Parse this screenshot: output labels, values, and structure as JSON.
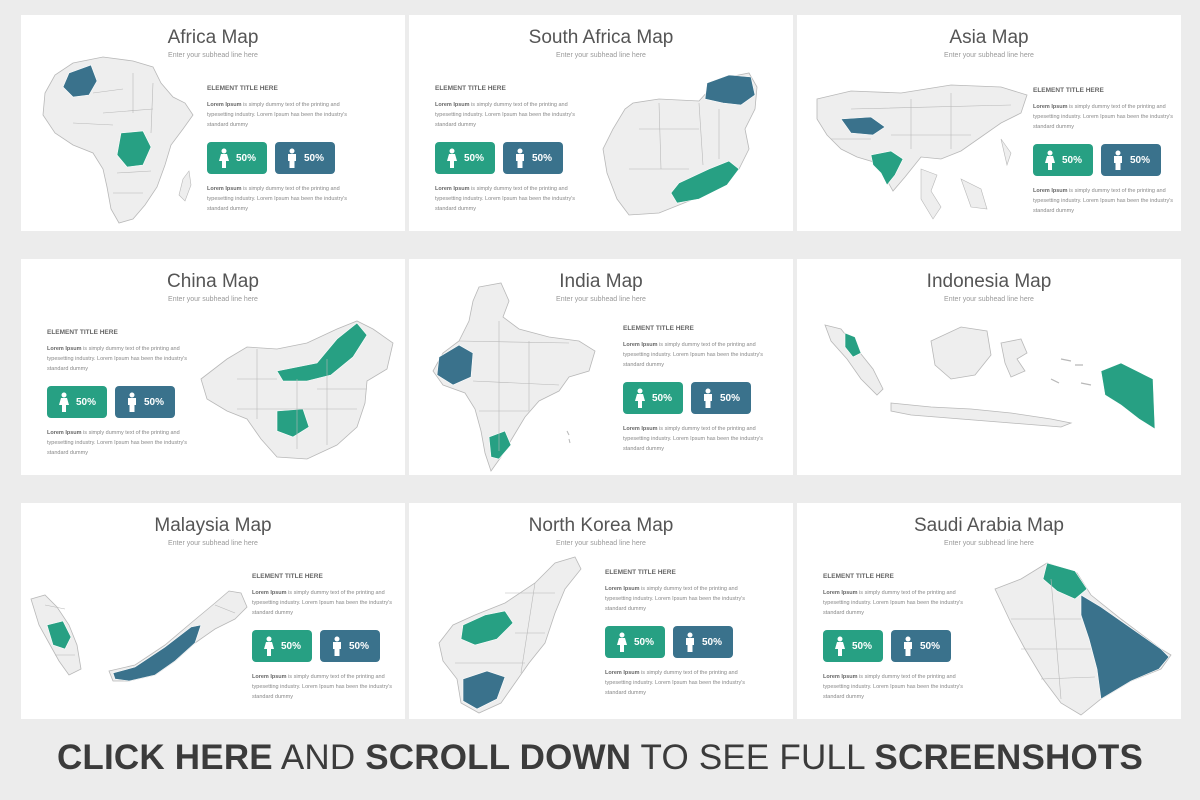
{
  "colors": {
    "teal": "#27a083",
    "blue": "#3a728c",
    "land": "#eeeeee",
    "border": "#b8b8b8"
  },
  "common": {
    "subhead": "Enter your subhead line here",
    "element_title": "ELEMENT TITLE HERE",
    "lorem_bold": "Lorem Ipsum",
    "lorem_rest": " is simply dummy text of the printing and typesetting industry. Lorem Ipsum has been the industry's standard dummy",
    "female_pct": "50%",
    "male_pct": "50%",
    "female_icon": "female-person-icon",
    "male_icon": "male-person-icon"
  },
  "slides": [
    {
      "title": "Africa Map"
    },
    {
      "title": "South Africa Map"
    },
    {
      "title": "Asia Map"
    },
    {
      "title": "China Map"
    },
    {
      "title": "India Map"
    },
    {
      "title": "Indonesia Map"
    },
    {
      "title": "Malaysia Map"
    },
    {
      "title": "North Korea Map"
    },
    {
      "title": "Saudi Arabia Map"
    }
  ],
  "banner": {
    "part1": "CLICK HERE",
    "part2": " AND ",
    "part3": "SCROLL DOWN",
    "part4": " TO SEE FULL ",
    "part5": "SCREENSHOTS"
  }
}
